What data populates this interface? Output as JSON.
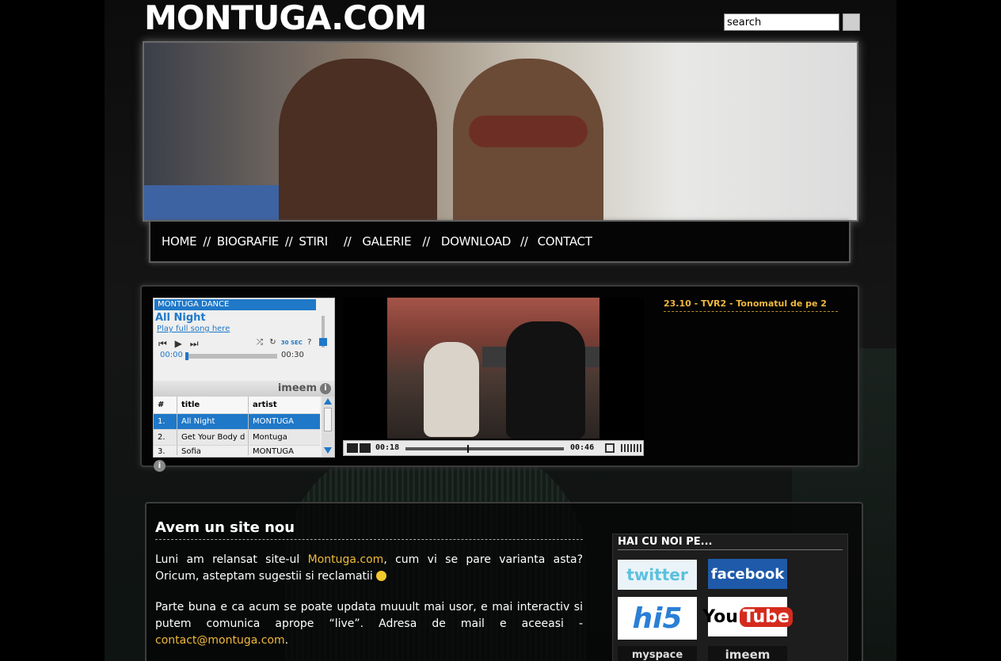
{
  "header": {
    "logo": "MONTUGA.COM",
    "search_value": "search"
  },
  "nav": {
    "items": [
      "HOME",
      "BIOGRAFIE",
      "STIRI",
      "GALERIE",
      "DOWNLOAD",
      "CONTACT"
    ],
    "separator": "//"
  },
  "player": {
    "playlist_name": "MONTUGA DANCE",
    "song": "All Night",
    "full_song_link": "Play full song here",
    "elapsed": "00:00",
    "duration": "00:30",
    "thirty_sec": "30 SEC",
    "brand": "imeem",
    "columns": [
      "#",
      "title",
      "artist"
    ],
    "rows": [
      {
        "num": "1.",
        "title": "All Night",
        "artist": "MONTUGA"
      },
      {
        "num": "2.",
        "title": "Get Your Body d",
        "artist": "Montuga"
      },
      {
        "num": "3.",
        "title": "Sofia",
        "artist": "MONTUGA"
      }
    ]
  },
  "video": {
    "elapsed": "00:18",
    "duration": "00:46",
    "progress": 0.39
  },
  "news": {
    "item": "23.10 - TVR2 - Tonomatul de pe 2"
  },
  "post": {
    "title": "Avem un site nou",
    "p1_before": "Luni am relansat site-ul ",
    "p1_link": "Montuga.com",
    "p1_after": ", cum vi se pare varianta asta? Oricum, asteptam sugestii si reclamatii ",
    "p2_text": "Parte buna e ca acum se poate updata muuult mai usor, e mai interactiv si putem comunica aprope “live”. Adresa de mail e aceeasi - ",
    "p2_link": "contact@montuga.com",
    "p2_after": "."
  },
  "sidebar": {
    "title": "HAI CU NOI PE...",
    "twitter": "twitter",
    "facebook": "facebook",
    "hi5": "hi5",
    "youtube_you": "You",
    "youtube_tube": "Tube",
    "myspace": "myspace",
    "imeem": "imeem"
  },
  "colors": {
    "accent": "#f0b93c",
    "player_blue": "#1f78c8"
  }
}
